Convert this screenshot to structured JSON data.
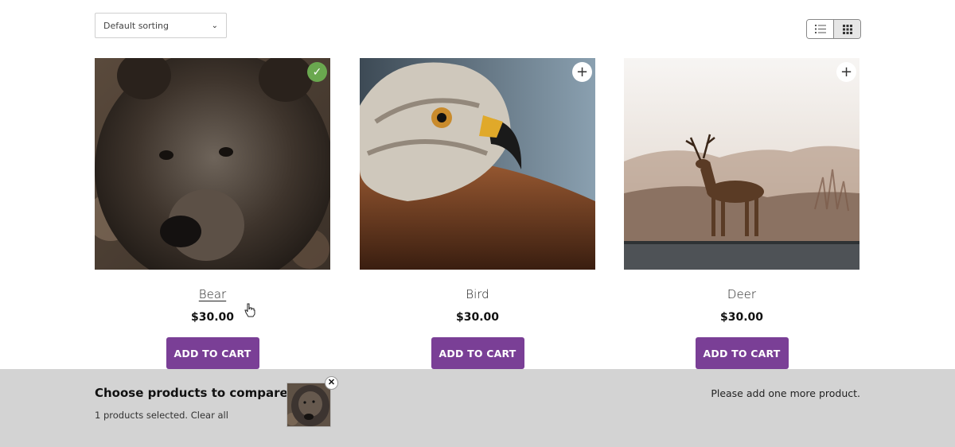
{
  "toolbar": {
    "sort_value": "Default sorting",
    "views": [
      {
        "icon": "list-view-icon",
        "active": false
      },
      {
        "icon": "grid-view-icon",
        "active": true
      }
    ]
  },
  "products": [
    {
      "name": "Bear",
      "price": "$30.00",
      "button": "ADD TO CART",
      "compare_state": "checked",
      "compare_icon": "checkmark-icon"
    },
    {
      "name": "Bird",
      "price": "$30.00",
      "button": "ADD TO CART",
      "compare_state": "add",
      "compare_icon": "plus-icon"
    },
    {
      "name": "Deer",
      "price": "$30.00",
      "button": "ADD TO CART",
      "compare_state": "add",
      "compare_icon": "plus-icon"
    }
  ],
  "compare_bar": {
    "title": "Choose products to compare",
    "selected_text": "1 products selected.",
    "clear_label": "Clear all",
    "hint": "Please add one more product.",
    "remove_icon": "close-icon"
  },
  "colors": {
    "accent": "#7a3f96",
    "checked": "#6aa84f",
    "compare_bar_bg": "#d3d3d3"
  }
}
